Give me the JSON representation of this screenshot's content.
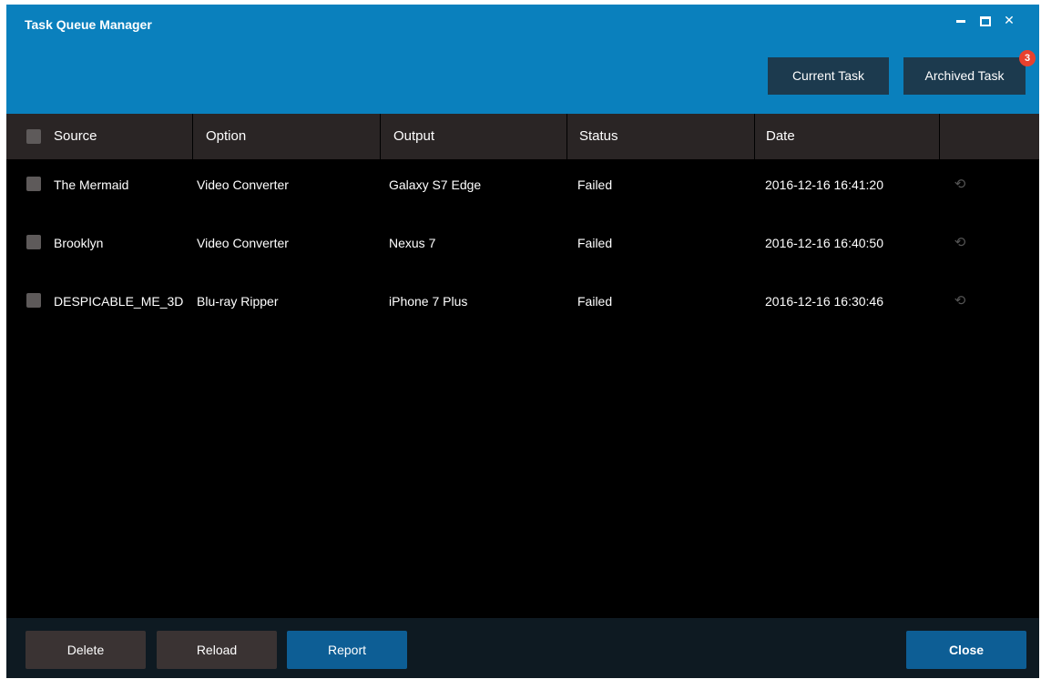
{
  "window": {
    "title": "Task Queue Manager",
    "controls": {
      "minimize": "minimize-icon",
      "maximize": "maximize-icon",
      "close": "close-icon"
    }
  },
  "tabs": {
    "current_label": "Current Task",
    "archived_label": "Archived Task",
    "archived_badge": "3"
  },
  "table": {
    "columns": [
      "Source",
      "Option",
      "Output",
      "Status",
      "Date"
    ],
    "rows": [
      {
        "source": "The Mermaid",
        "option": "Video Converter",
        "output": "Galaxy S7 Edge",
        "status": "Failed",
        "date": "2016-12-16 16:41:20",
        "action_icon": "retry-icon"
      },
      {
        "source": "Brooklyn",
        "option": "Video Converter",
        "output": "Nexus 7",
        "status": "Failed",
        "date": "2016-12-16 16:40:50",
        "action_icon": "retry-icon"
      },
      {
        "source": "DESPICABLE_ME_3D",
        "option": "Blu-ray Ripper",
        "output": "iPhone 7 Plus",
        "status": "Failed",
        "date": "2016-12-16 16:30:46",
        "action_icon": "retry-icon"
      }
    ]
  },
  "footer": {
    "delete_label": "Delete",
    "reload_label": "Reload",
    "report_label": "Report",
    "close_label": "Close"
  },
  "colors": {
    "title_bar": "#0a80bd",
    "tab_button": "#1c3a4e",
    "badge": "#e8412e",
    "header_row": "#2a2525",
    "body_bg": "#000000",
    "footer_bg": "#0e1a22",
    "primary_button": "#0d5e95",
    "secondary_button": "#3a3333"
  }
}
